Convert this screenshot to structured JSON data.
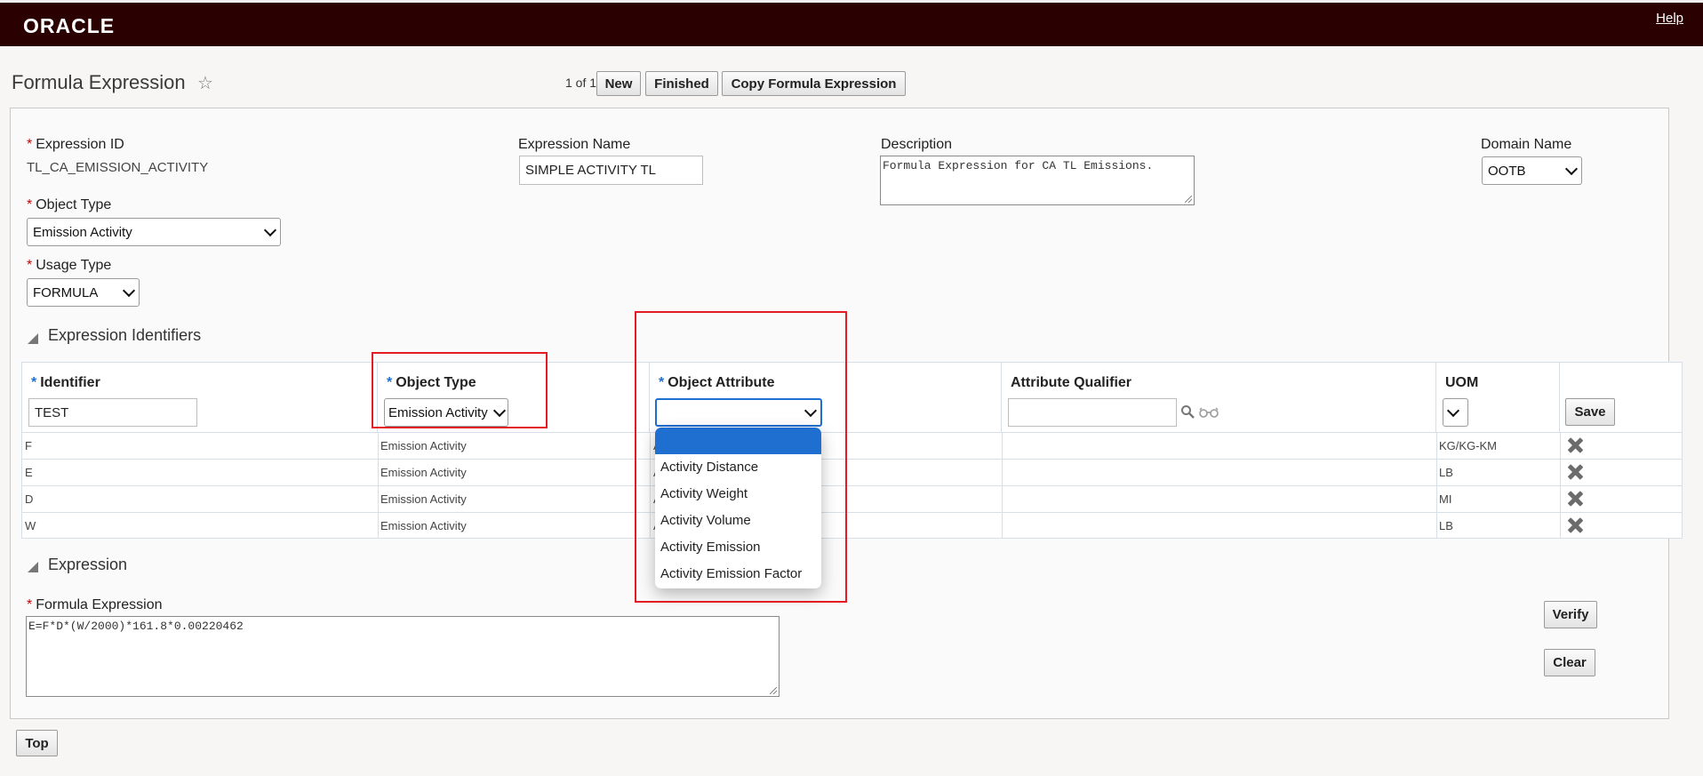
{
  "header": {
    "logo": "ORACLE",
    "help_label": "Help"
  },
  "page": {
    "title": "Formula Expression",
    "pager": "1 of 1",
    "buttons": {
      "new": "New",
      "finished": "Finished",
      "copy": "Copy Formula Expression"
    }
  },
  "form": {
    "expression_id": {
      "label": "Expression ID",
      "value": "TL_CA_EMISSION_ACTIVITY"
    },
    "expression_name": {
      "label": "Expression Name",
      "value": "SIMPLE ACTIVITY TL"
    },
    "description": {
      "label": "Description",
      "value": "Formula Expression for CA TL Emissions."
    },
    "domain_name": {
      "label": "Domain Name",
      "value": "OOTB"
    },
    "object_type": {
      "label": "Object Type",
      "value": "Emission Activity"
    },
    "usage_type": {
      "label": "Usage Type",
      "value": "FORMULA"
    }
  },
  "identifiers": {
    "section_title": "Expression Identifiers",
    "columns": {
      "identifier": "Identifier",
      "object_type": "Object Type",
      "object_attribute": "Object Attribute",
      "attribute_qualifier": "Attribute Qualifier",
      "uom": "UOM"
    },
    "new_row": {
      "identifier": "TEST",
      "object_type": "Emission Activity",
      "object_attribute": "",
      "attribute_qualifier": "",
      "uom": ""
    },
    "save_label": "Save",
    "rows": [
      {
        "identifier": "F",
        "object_type": "Emission Activity",
        "attr": "A",
        "uom": "KG/KG-KM"
      },
      {
        "identifier": "E",
        "object_type": "Emission Activity",
        "attr": "A",
        "uom": "LB"
      },
      {
        "identifier": "D",
        "object_type": "Emission Activity",
        "attr": "A",
        "uom": "MI"
      },
      {
        "identifier": "W",
        "object_type": "Emission Activity",
        "attr": "A",
        "uom": "LB"
      }
    ],
    "dropdown_options": [
      "",
      "Activity Distance",
      "Activity Weight",
      "Activity Volume",
      "Activity Emission",
      "Activity Emission Factor"
    ]
  },
  "expression": {
    "section_title": "Expression",
    "label": "Formula Expression",
    "value": "E=F*D*(W/2000)*161.8*0.00220462",
    "verify_label": "Verify",
    "clear_label": "Clear"
  },
  "footer": {
    "top_label": "Top"
  },
  "colors": {
    "header_bg": "#2a0000",
    "required_red": "#cc0000",
    "required_blue": "#1f6fd1",
    "highlight_red": "#e31b23",
    "selected_blue": "#1f6fd1"
  }
}
